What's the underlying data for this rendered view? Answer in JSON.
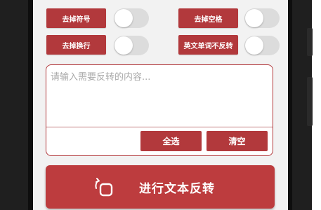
{
  "options": {
    "remove_symbols": {
      "label": "去掉符号",
      "enabled": false
    },
    "remove_spaces": {
      "label": "去掉空格",
      "enabled": false
    },
    "remove_newlines": {
      "label": "去掉换行",
      "enabled": false
    },
    "keep_english_words": {
      "label": "英文单词不反转",
      "enabled": false
    }
  },
  "editor": {
    "placeholder": "请输入需要反转的内容...",
    "value": "",
    "select_all_label": "全选",
    "clear_label": "清空"
  },
  "primary_action": {
    "label": "进行文本反转",
    "icon": "rotate-icon"
  },
  "colors": {
    "accent": "#b2393c",
    "toggle_off": "#dcdcdc",
    "screen_bg": "#f2f2f2"
  }
}
